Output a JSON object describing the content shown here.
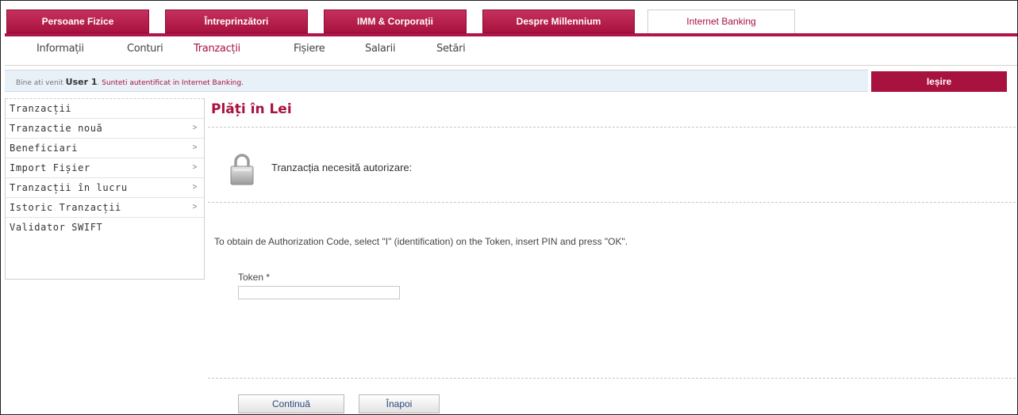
{
  "top_tabs": [
    {
      "label": "Persoane Fizice"
    },
    {
      "label": "Întreprinzători"
    },
    {
      "label": "IMM & Corporații"
    },
    {
      "label": "Despre Millennium"
    },
    {
      "label": "Internet Banking"
    }
  ],
  "subnav": [
    {
      "label": "Informații"
    },
    {
      "label": "Conturi"
    },
    {
      "label": "Tranzacții"
    },
    {
      "label": "Fișiere"
    },
    {
      "label": "Salarii"
    },
    {
      "label": "Setări"
    }
  ],
  "welcome": {
    "prefix": "Bine ati venit",
    "user": "User 1",
    "auth_text": "Sunteti autentificat in Internet Banking."
  },
  "logout_label": "Ieșire",
  "sidebar": {
    "header": "Tranzacții",
    "items": [
      {
        "label": "Tranzactie nouă",
        "arrow": ">"
      },
      {
        "label": "Beneficiari",
        "arrow": ">"
      },
      {
        "label": "Import Fișier",
        "arrow": ">"
      },
      {
        "label": "Tranzacții în lucru",
        "arrow": ">"
      },
      {
        "label": "Istoric Tranzacții",
        "arrow": ">"
      },
      {
        "label": "Validator SWIFT",
        "arrow": ""
      }
    ]
  },
  "main": {
    "title": "Plăți în Lei",
    "auth_message": "Tranzacția necesită autorizare:",
    "instructions": "To obtain de Authorization Code, select \"I\" (identification) on the Token, insert PIN and press \"OK\".",
    "token_label": "Token *",
    "token_value": "",
    "continue_label": "Continuă",
    "back_label": "Înapoi"
  },
  "colors": {
    "brand": "#a8123f",
    "welcome_bg": "#e8f0f8"
  },
  "icons": {
    "lock": "lock-icon"
  }
}
